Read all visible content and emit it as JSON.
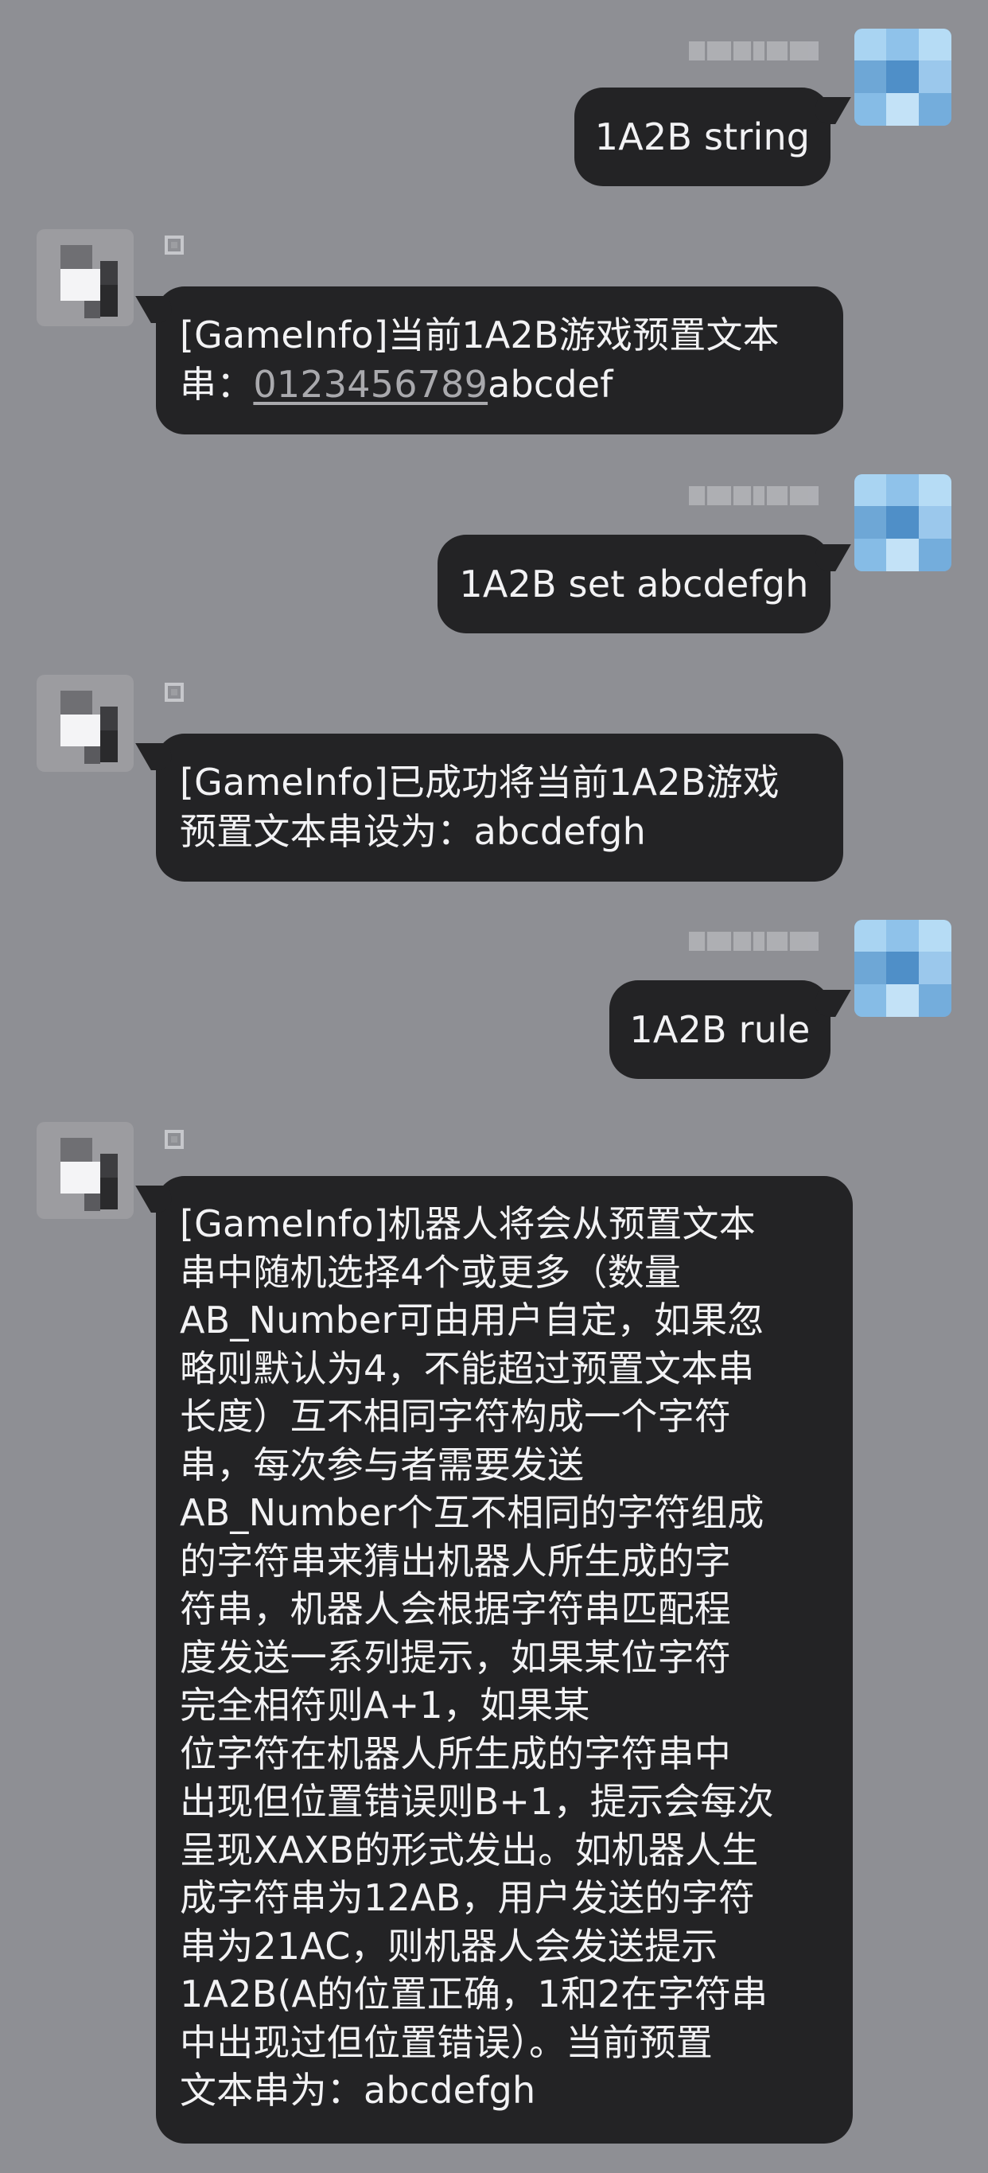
{
  "conversation": {
    "messages": [
      {
        "sender": "user",
        "lines": [
          "1A2B string"
        ]
      },
      {
        "sender": "bot",
        "lines": [
          "[GameInfo]当前1A2B游戏预置文本",
          "串："
        ],
        "link_text": "0123456789",
        "after_link": "abcdef"
      },
      {
        "sender": "user",
        "lines": [
          "1A2B set abcdefgh"
        ]
      },
      {
        "sender": "bot",
        "lines": [
          "[GameInfo]已成功将当前1A2B游戏",
          "预置文本串设为：abcdefgh"
        ]
      },
      {
        "sender": "user",
        "lines": [
          "1A2B rule"
        ]
      },
      {
        "sender": "bot",
        "lines": [
          "[GameInfo]机器人将会从预置文本",
          "串中随机选择4个或更多（数量",
          "AB_Number可由用户自定，如果忽",
          "略则默认为4，不能超过预置文本串",
          "长度）互不相同字符构成一个字符",
          "串，每次参与者需要发送",
          "AB_Number个互不相同的字符组成",
          "的字符串来猜出机器人所生成的字",
          "符串，机器人会根据字符串匹配程",
          "度发送一系列提示，如果某位字符",
          "完全相符则A+1，如果某",
          "位字符在机器人所生成的字符串中",
          "出现但位置错误则B+1，提示会每次",
          "呈现XAXB的形式发出。如机器人生",
          "成字符串为12AB，用户发送的字符",
          "串为21AC，则机器人会发送提示",
          "1A2B(A的位置正确，1和2在字符串",
          "中出现过但位置错误）。当前预置",
          "文本串为：abcdefgh"
        ]
      }
    ]
  },
  "colors": {
    "background": "#8e8f94",
    "bubble": "#232325",
    "bubble_text": "#f2f2f4",
    "link": "#a9a9ad"
  }
}
